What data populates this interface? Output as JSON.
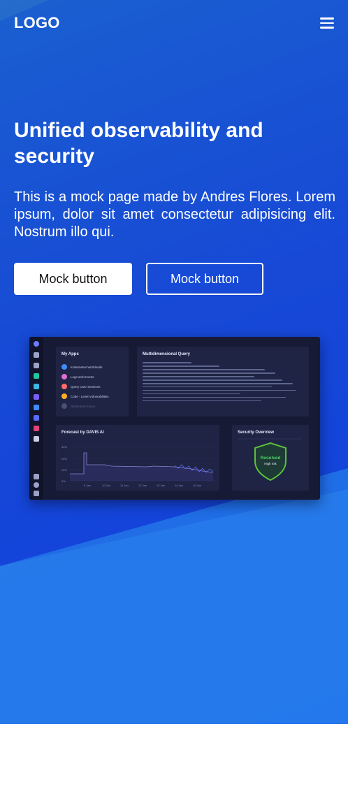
{
  "header": {
    "logo": "LOGO",
    "menu_icon": "hamburger-menu-icon"
  },
  "hero": {
    "title": "Unified observability and security",
    "lead": "This is a mock page made by Andres Flores. Lorem ipsum, dolor sit amet consectetur adipisicing elit. Nostrum illo qui.",
    "primary_button": "Mock button",
    "secondary_button": "Mock button",
    "colors": {
      "background": "#1748d6",
      "accent": "#ffffff"
    }
  },
  "dashboard": {
    "my_apps": {
      "title": "My Apps",
      "items": [
        "Kubernetes Workloads",
        "Logs and Events",
        "Query User Sessions",
        "Code - Level Vulnerabilities",
        "Distributed traces"
      ]
    },
    "query": {
      "title": "Multidimensional Query"
    },
    "forecast": {
      "title": "Forecast by DAVIS AI",
      "y_ticks": [
        "30%",
        "20%",
        "10%",
        "0%"
      ],
      "x_ticks": [
        "9 Jan",
        "10 Jan",
        "11 Jan",
        "12 Jan",
        "13 Jan",
        "14 Jan",
        "15 Jan"
      ]
    },
    "security": {
      "title": "Security Overview",
      "status": "Resolved",
      "risk": "High risk"
    }
  }
}
